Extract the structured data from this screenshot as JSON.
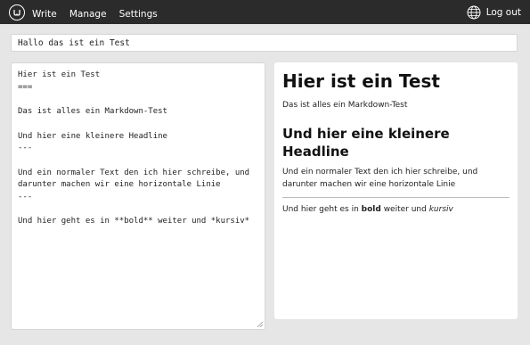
{
  "nav": {
    "logo_icon": "logo-icon",
    "items": [
      "Write",
      "Manage",
      "Settings"
    ],
    "logout": "Log out",
    "globe_icon": "globe-icon"
  },
  "title_field": {
    "value": "Hallo das ist ein Test"
  },
  "editor": {
    "markdown": "Hier ist ein Test\n===\n\nDas ist alles ein Markdown-Test\n\nUnd hier eine kleinere Headline\n---\n\nUnd ein normaler Text den ich hier schreibe, und darunter machen wir eine horizontale Linie\n---\n\nUnd hier geht es in **bold** weiter und *kursiv*"
  },
  "preview": {
    "h1": "Hier ist ein Test",
    "p1": "Das ist alles ein Markdown-Test",
    "h2": "Und hier eine kleinere Headline",
    "p2": "Und ein normaler Text den ich hier schreibe, und darunter machen wir eine horizontale Linie",
    "p3_prefix": "Und hier geht es in ",
    "p3_bold": "bold",
    "p3_mid": " weiter und ",
    "p3_italic": "kursiv"
  },
  "colors": {
    "topbar": "#2b2b2b",
    "background": "#e6e6e6",
    "panel": "#ffffff"
  }
}
